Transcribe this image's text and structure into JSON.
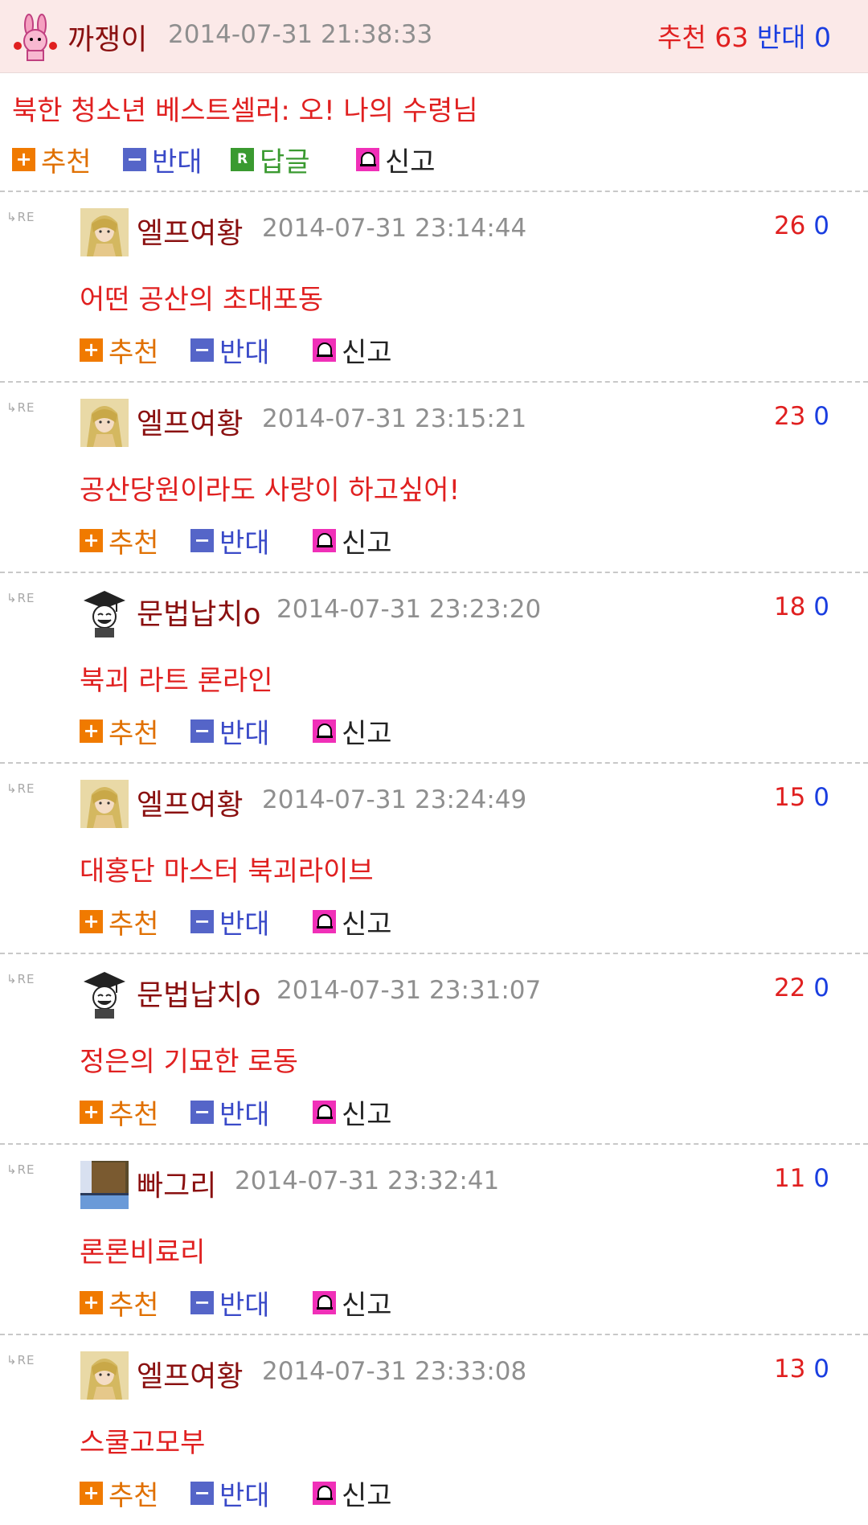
{
  "post": {
    "author": "까쟁이",
    "date": "2014-07-31 21:38:33",
    "recommend_label": "추천",
    "recommend_count": "63",
    "oppose_label": "반대",
    "oppose_count": "0",
    "title": "북한 청소년 베스트셀러: 오! 나의 수령님"
  },
  "actions": {
    "recommend": "추천",
    "oppose": "반대",
    "reply": "답글",
    "report": "신고",
    "re_marker": "RE"
  },
  "comments": [
    {
      "author": "엘프여황",
      "date": "2014-07-31 23:14:44",
      "up": "26",
      "down": "0",
      "text": "어떤 공산의 초대포동",
      "avatar": "elf"
    },
    {
      "author": "엘프여황",
      "date": "2014-07-31 23:15:21",
      "up": "23",
      "down": "0",
      "text": "공산당원이라도 사랑이 하고싶어!",
      "avatar": "elf"
    },
    {
      "author": "문법납치o",
      "date": "2014-07-31 23:23:20",
      "up": "18",
      "down": "0",
      "text": "북괴 라트 론라인",
      "avatar": "grad"
    },
    {
      "author": "엘프여황",
      "date": "2014-07-31 23:24:49",
      "up": "15",
      "down": "0",
      "text": "대홍단 마스터 북괴라이브",
      "avatar": "elf"
    },
    {
      "author": "문법납치o",
      "date": "2014-07-31 23:31:07",
      "up": "22",
      "down": "0",
      "text": "정은의 기묘한 로동",
      "avatar": "grad"
    },
    {
      "author": "빠그리",
      "date": "2014-07-31 23:32:41",
      "up": "11",
      "down": "0",
      "text": "론론비료리",
      "avatar": "block"
    },
    {
      "author": "엘프여황",
      "date": "2014-07-31 23:33:08",
      "up": "13",
      "down": "0",
      "text": "스쿨고모부",
      "avatar": "elf"
    }
  ],
  "colors": {
    "header_bg": "#fbe9e8",
    "comment_text": "#e02020",
    "nickname": "#8a1010",
    "recommend": "#e07000",
    "oppose": "#3a4ac8",
    "up_count": "#e02020",
    "down_count": "#1a3ee0"
  }
}
